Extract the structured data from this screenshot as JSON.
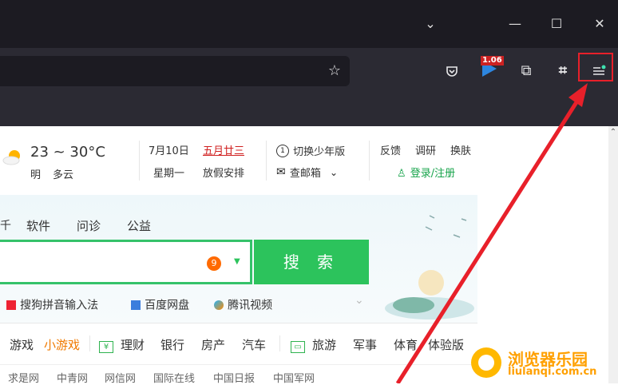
{
  "browser": {
    "extension_badge": "1.06"
  },
  "weather": {
    "temp": "23 ~ 30°C",
    "day": "明",
    "condition": "多云"
  },
  "calendar": {
    "date": "7月10日",
    "lunar": "五月廿三",
    "weekday": "星期一",
    "holiday": "放假安排"
  },
  "tools": {
    "youth_mode": "切换少年版",
    "mail": "查邮箱",
    "feedback": "反馈",
    "survey": "调研",
    "skin": "换肤",
    "login": "登录/注册"
  },
  "tabs": [
    "软件",
    "问诊",
    "公益"
  ],
  "search": {
    "badge": "9",
    "button": "搜 索"
  },
  "quick_links": [
    "搜狗拼音输入法",
    "百度网盘",
    "腾讯视频"
  ],
  "nav": {
    "game": "游戏",
    "mini_game": "小游戏",
    "finance": "理财",
    "bank": "银行",
    "house": "房产",
    "car": "汽车",
    "travel": "旅游",
    "military": "军事",
    "sports": "体育",
    "trial": "体验版"
  },
  "news_links": [
    "求是网",
    "中青网",
    "网信网",
    "国际在线",
    "中国日报",
    "中国军网"
  ],
  "watermark": {
    "title": "浏览器乐园",
    "url": "liulanqi.com.cn"
  },
  "colors": {
    "accent_green": "#2cc35c",
    "highlight_red": "#e8202a",
    "dark_titlebar": "#1c1b22"
  }
}
